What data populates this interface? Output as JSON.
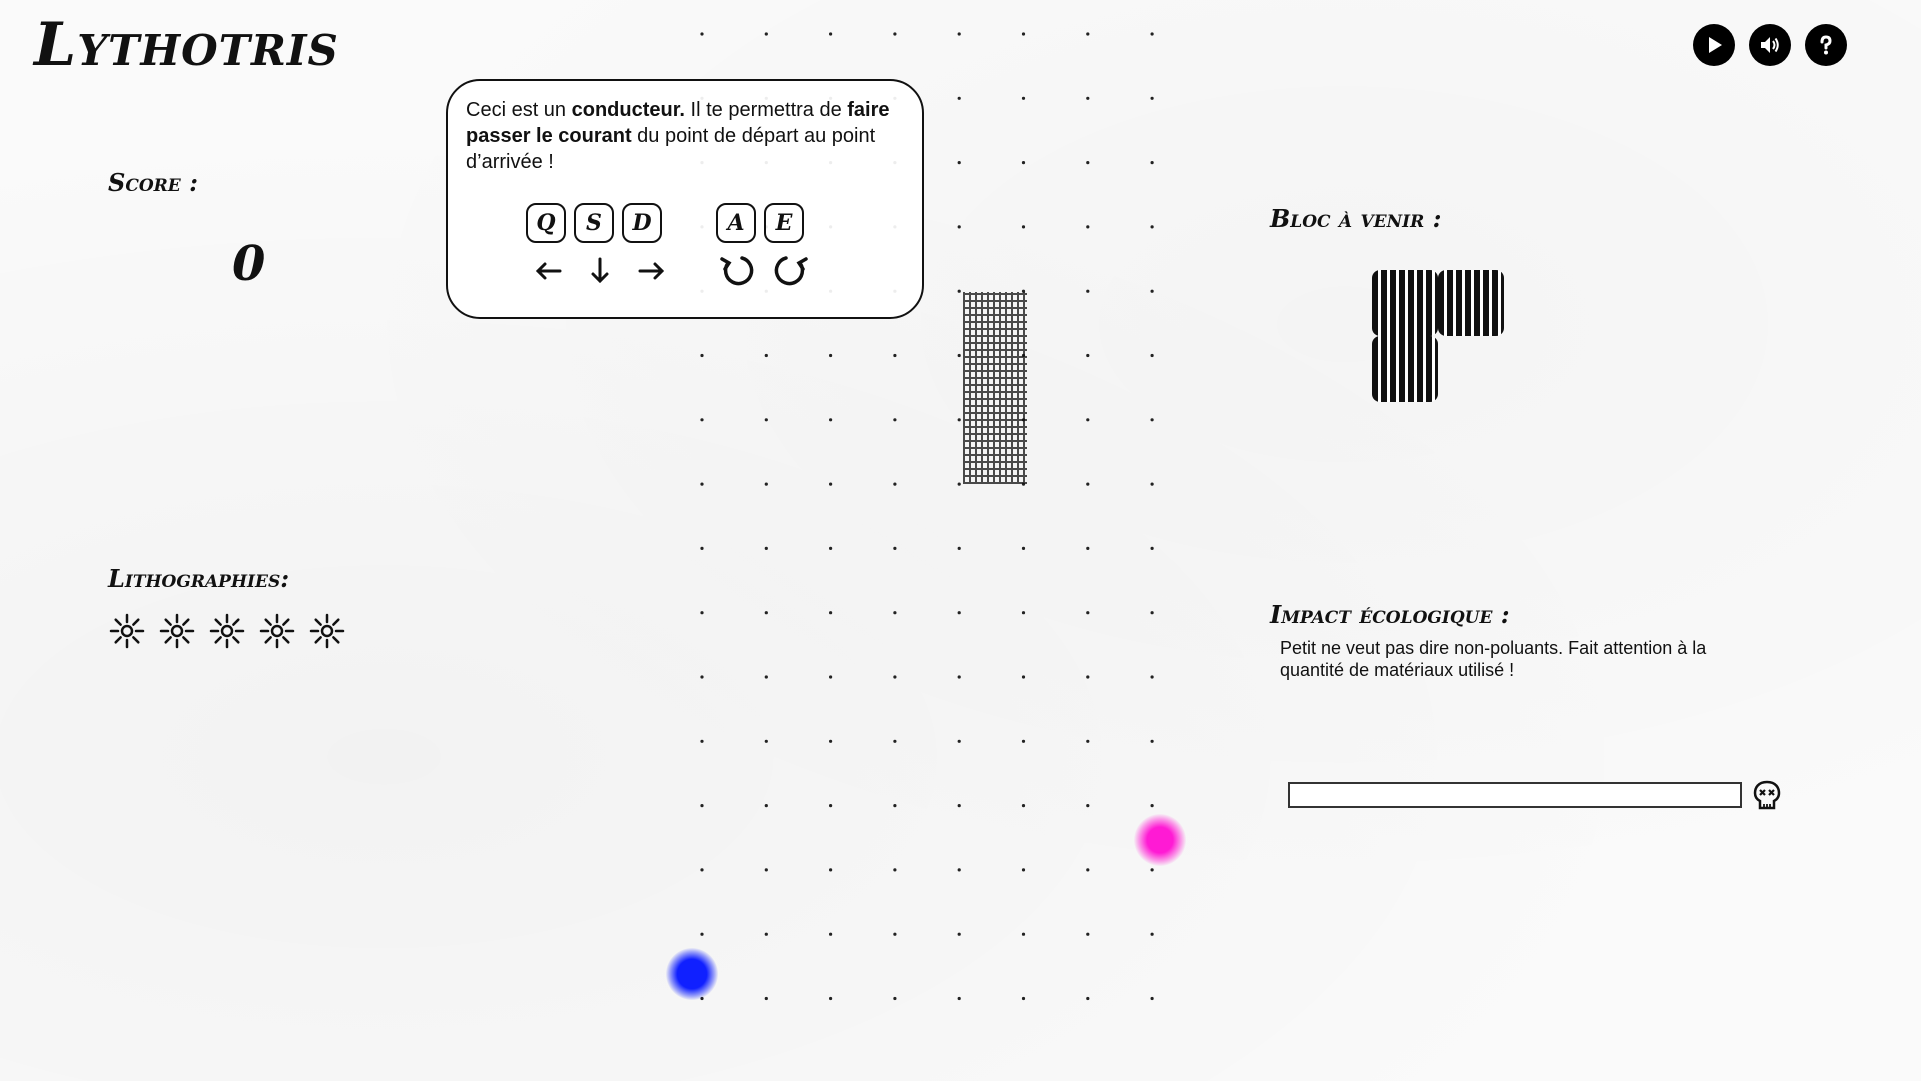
{
  "app": {
    "title": "Lythotris"
  },
  "top_icons": [
    "play-icon",
    "sound-icon",
    "help-icon"
  ],
  "score": {
    "label": "Score :",
    "value": "0"
  },
  "lithographies": {
    "label": "Lithographies:",
    "count": 5,
    "icon": "sun-icon"
  },
  "tutorial": {
    "text_parts": {
      "p1": "Ceci est un ",
      "b1": "conducteur.",
      "p2": " Il te permettra de ",
      "b2": "faire passer le courant",
      "p3": " du point de départ au point d’arrivée !"
    },
    "move_keys": [
      "Q",
      "S",
      "D"
    ],
    "rotate_keys": [
      "A",
      "E"
    ],
    "move_icons": [
      "arrow-left-icon",
      "arrow-down-icon",
      "arrow-right-icon"
    ],
    "rotate_icons": [
      "rotate-left-icon",
      "rotate-right-icon"
    ]
  },
  "next_block": {
    "label": "Bloc à venir :"
  },
  "impact": {
    "label": "Impact écologique :",
    "text": "Petit ne veut pas dire non-poluants. Fait attention à la quantité de matériaux utilisé !",
    "level": 0,
    "icon": "skull-icon"
  },
  "colors": {
    "start": "#1020ff",
    "end": "#ff1ad4",
    "ink": "#111111"
  }
}
